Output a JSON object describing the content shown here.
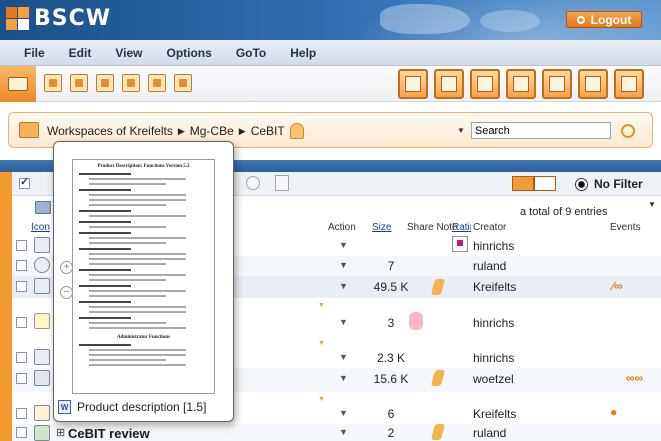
{
  "app": {
    "logo_text": "BSCW",
    "logout_label": "Logout"
  },
  "menu": [
    "File",
    "Edit",
    "View",
    "Options",
    "GoTo",
    "Help"
  ],
  "breadcrumb": {
    "items": [
      "Workspaces of Kreifelts",
      "Mg-CBe",
      "CeBIT"
    ]
  },
  "search": {
    "label": "Search",
    "value": ""
  },
  "filter": {
    "label": "No Filter"
  },
  "list": {
    "total": "a total of 9 entries",
    "headers": {
      "icon": "Icon",
      "action": "Action",
      "size": "Size",
      "share_note": "Share Note",
      "rating": "Rating",
      "creator": "Creator",
      "events": "Events"
    },
    "rows": [
      {
        "size": "",
        "creator": "hinrichs"
      },
      {
        "size": "7",
        "creator": "ruland"
      },
      {
        "size": "49.5 K",
        "creator": "Kreifelts"
      },
      {
        "size": "3",
        "creator": "hinrichs"
      },
      {
        "size": "2.3 K",
        "creator": "hinrichs"
      },
      {
        "size": "15.6 K",
        "creator": "woetzel"
      },
      {
        "size": "6",
        "creator": "Kreifelts"
      },
      {
        "name": "CeBIT review",
        "size": "2",
        "creator": "ruland"
      }
    ]
  },
  "preview": {
    "caption": "Product description [1.5]",
    "doc_title": "Product Description: Functions Version 5.2",
    "doc_subtitle": "Administrator Functions",
    "zoom_in": "+",
    "zoom_out": "−"
  }
}
